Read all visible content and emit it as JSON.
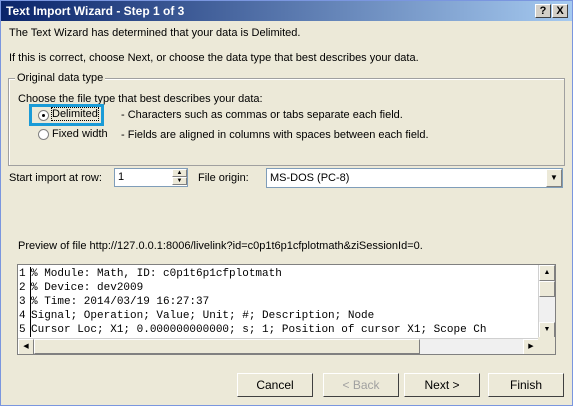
{
  "window": {
    "title": "Text Import Wizard - Step 1 of 3",
    "help_label": "?",
    "close_label": "X"
  },
  "intro": {
    "line1": "The Text Wizard has determined that your data is Delimited.",
    "line2": "If this is correct, choose Next, or choose the data type that best describes your data."
  },
  "original_data_type": {
    "legend": "Original data type",
    "prompt": "Choose the file type that best describes your data:",
    "options": [
      {
        "label": "Delimited",
        "description": "- Characters such as commas or tabs separate each field.",
        "selected": true
      },
      {
        "label": "Fixed width",
        "description": "- Fields are aligned in columns with spaces between each field.",
        "selected": false
      }
    ]
  },
  "start_row": {
    "label": "Start import at row:",
    "value": "1"
  },
  "file_origin": {
    "label": "File origin:",
    "value": "MS-DOS (PC-8)"
  },
  "preview": {
    "label": "Preview of file http://127.0.0.1:8006/livelink?id=c0p1t6p1cfplotmath&ziSessionId=0.",
    "lines": [
      {
        "num": "1",
        "text": "% Module: Math, ID: c0p1t6p1cfplotmath"
      },
      {
        "num": "2",
        "text": "% Device: dev2009"
      },
      {
        "num": "3",
        "text": "% Time: 2014/03/19 16:27:37"
      },
      {
        "num": "4",
        "text": "Signal; Operation; Value; Unit; #; Description; Node"
      },
      {
        "num": "5",
        "text": "Cursor Loc; X1;    0.000000000000; s; 1; Position of cursor X1; Scope Ch"
      }
    ]
  },
  "buttons": {
    "cancel": "Cancel",
    "back": "< Back",
    "next": "Next >",
    "finish": "Finish"
  },
  "colors": {
    "highlight": "#1a9bd7",
    "title_gradient_start": "#0a246a",
    "title_gradient_end": "#a6caf0"
  }
}
